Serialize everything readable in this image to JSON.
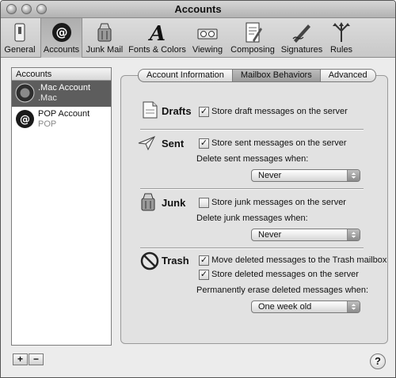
{
  "window": {
    "title": "Accounts"
  },
  "toolbar": {
    "items": [
      {
        "label": "General",
        "icon": "switch-icon"
      },
      {
        "label": "Accounts",
        "icon": "at-sign-icon"
      },
      {
        "label": "Junk Mail",
        "icon": "trash-junk-icon"
      },
      {
        "label": "Fonts & Colors",
        "icon": "font-a-icon"
      },
      {
        "label": "Viewing",
        "icon": "glasses-icon"
      },
      {
        "label": "Composing",
        "icon": "document-pencil-icon"
      },
      {
        "label": "Signatures",
        "icon": "pen-signature-icon"
      },
      {
        "label": "Rules",
        "icon": "rules-arrows-icon"
      }
    ],
    "selected": "Accounts"
  },
  "sidebar": {
    "header": "Accounts",
    "accounts": [
      {
        "name": ".Mac Account",
        "type": ".Mac"
      },
      {
        "name": "POP Account",
        "type": "POP"
      }
    ]
  },
  "buttons": {
    "add": "+",
    "remove": "−",
    "help": "?"
  },
  "tabs": [
    "Account Information",
    "Mailbox Behaviors",
    "Advanced"
  ],
  "selected_tab": "Mailbox Behaviors",
  "sections": {
    "drafts": {
      "label": "Drafts",
      "check": "Store draft messages on the server",
      "checked": true
    },
    "sent": {
      "label": "Sent",
      "check": "Store sent messages on the server",
      "checked": true,
      "delete_label": "Delete sent messages when:",
      "delete_value": "Never"
    },
    "junk": {
      "label": "Junk",
      "check": "Store junk messages on the server",
      "checked": false,
      "delete_label": "Delete junk messages when:",
      "delete_value": "Never"
    },
    "trash": {
      "label": "Trash",
      "check1": "Move deleted messages to the Trash mailbox",
      "check1_checked": true,
      "check2": "Store deleted messages on the server",
      "check2_checked": true,
      "erase_label": "Permanently erase deleted messages when:",
      "erase_value": "One week old"
    }
  }
}
